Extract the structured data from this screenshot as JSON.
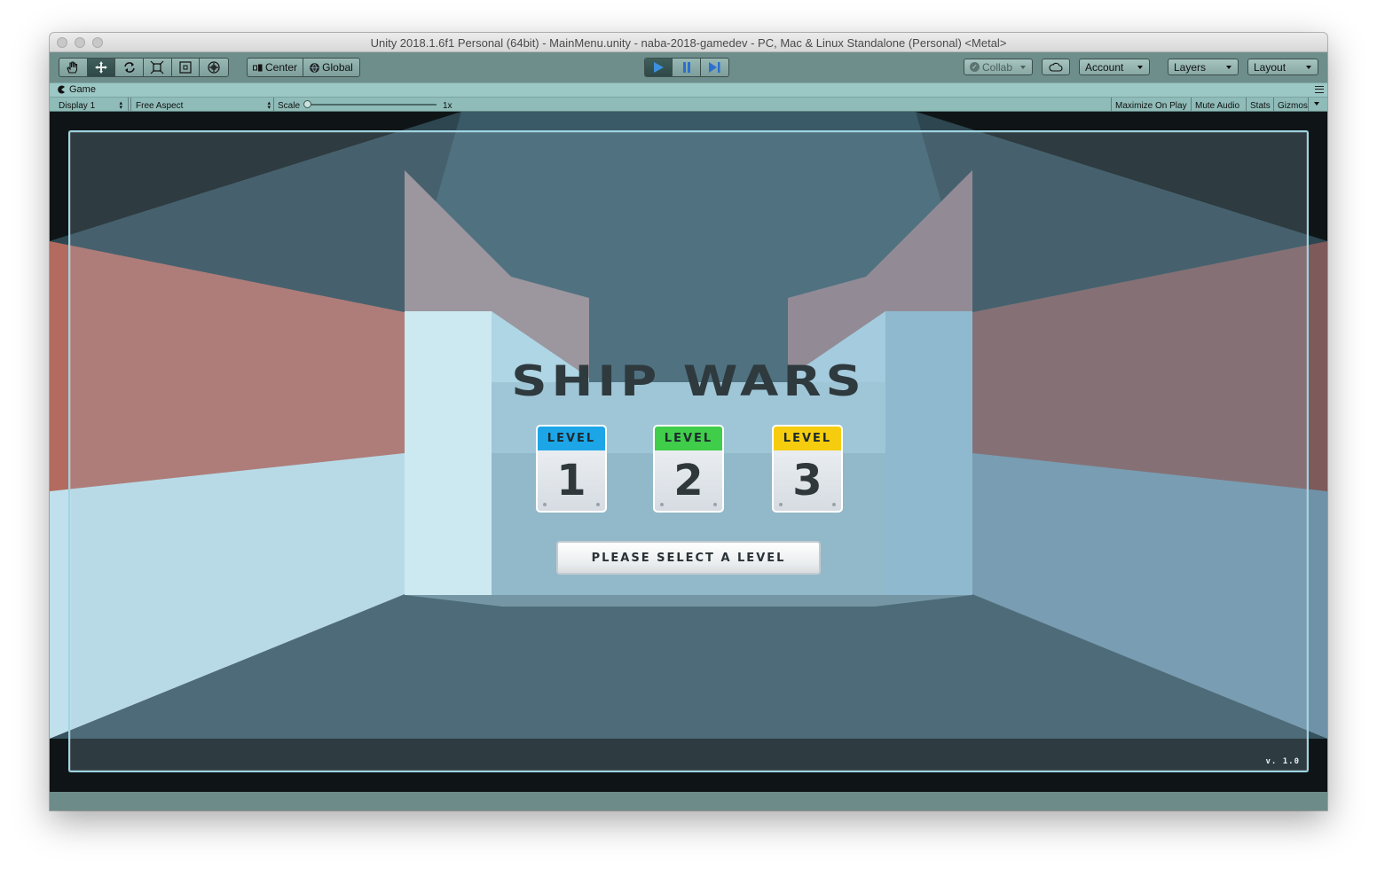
{
  "window": {
    "title": "Unity 2018.1.6f1 Personal (64bit) - MainMenu.unity - naba-2018-gamedev - PC, Mac & Linux Standalone (Personal) <Metal>"
  },
  "toolbar": {
    "tools": [
      "hand-tool-icon",
      "move-tool-icon",
      "rotate-tool-icon",
      "scale-tool-icon",
      "rect-tool-icon",
      "transform-tool-icon"
    ],
    "pivot_label": "Center",
    "space_label": "Global",
    "play_icon": "play-icon",
    "pause_icon": "pause-icon",
    "step_icon": "step-icon",
    "collab_label": "Collab",
    "account_label": "Account",
    "layers_label": "Layers",
    "layout_label": "Layout"
  },
  "game_view": {
    "tab_label": "Game",
    "display_label": "Display 1",
    "aspect_label": "Free Aspect",
    "scale_label": "Scale",
    "scale_value": "1x",
    "maximize_label": "Maximize On Play",
    "mute_label": "Mute Audio",
    "stats_label": "Stats",
    "gizmos_label": "Gizmos"
  },
  "game": {
    "title": "SHIP WARS",
    "levels": [
      {
        "header": "LEVEL",
        "number": "1",
        "color": "#1ca6e8"
      },
      {
        "header": "LEVEL",
        "number": "2",
        "color": "#3fcd4a"
      },
      {
        "header": "LEVEL",
        "number": "3",
        "color": "#f6cd0e"
      }
    ],
    "prompt": "PLEASE SELECT A LEVEL",
    "version": "v. 1.0"
  },
  "colors": {
    "unity_chrome": "#6e8e8b",
    "play_active": "#3d8fe0"
  }
}
